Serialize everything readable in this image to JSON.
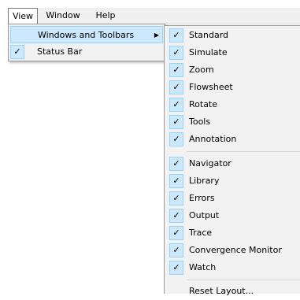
{
  "menubar": {
    "items": [
      {
        "label": "View"
      },
      {
        "label": "Window"
      },
      {
        "label": "Help"
      }
    ]
  },
  "view_menu": {
    "items": [
      {
        "label": "Windows and Toolbars",
        "checked": false,
        "submenu": true,
        "highlighted": true
      },
      {
        "label": "Status Bar",
        "checked": true
      }
    ]
  },
  "toolbars_menu": {
    "group1": [
      {
        "label": "Standard",
        "checked": true
      },
      {
        "label": "Simulate",
        "checked": true
      },
      {
        "label": "Zoom",
        "checked": true
      },
      {
        "label": "Flowsheet",
        "checked": true
      },
      {
        "label": "Rotate",
        "checked": true
      },
      {
        "label": "Tools",
        "checked": true
      },
      {
        "label": "Annotation",
        "checked": true
      }
    ],
    "group2": [
      {
        "label": "Navigator",
        "checked": true
      },
      {
        "label": "Library",
        "checked": true
      },
      {
        "label": "Errors",
        "checked": true
      },
      {
        "label": "Output",
        "checked": true
      },
      {
        "label": "Trace",
        "checked": true
      },
      {
        "label": "Convergence Monitor",
        "checked": true
      },
      {
        "label": "Watch",
        "checked": true
      }
    ],
    "reset_label": "Reset Layout..."
  },
  "icons": {
    "check_glyph": "✓",
    "submenu_arrow": "▶"
  },
  "colors": {
    "menu_bg": "#f2f2f2",
    "highlight_bg": "#cce8ff",
    "highlight_border": "#99d1ff"
  }
}
